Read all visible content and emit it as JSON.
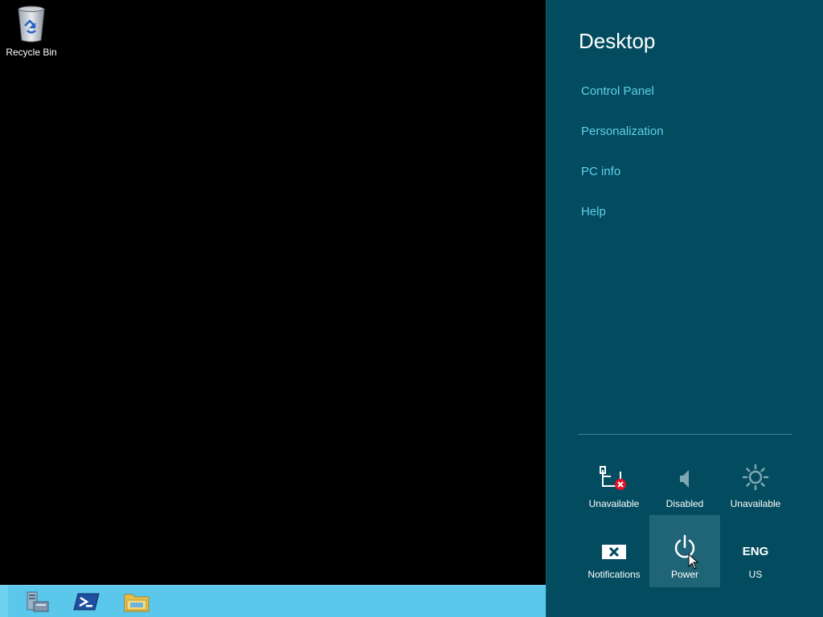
{
  "desktop": {
    "icons": [
      {
        "label": "Recycle Bin",
        "icon": "recycle-bin-icon"
      }
    ]
  },
  "taskbar": {
    "buttons": [
      {
        "name": "server-manager",
        "icon": "server-manager-icon"
      },
      {
        "name": "powershell",
        "icon": "powershell-icon"
      },
      {
        "name": "file-explorer",
        "icon": "folder-icon"
      }
    ],
    "color": "#5bc7ea"
  },
  "charms": {
    "title": "Desktop",
    "background": "#034c5f",
    "link_color": "#5fd0e8",
    "links": [
      {
        "label": "Control Panel"
      },
      {
        "label": "Personalization"
      },
      {
        "label": "PC info"
      },
      {
        "label": "Help"
      }
    ],
    "tiles": [
      {
        "label": "Unavailable",
        "icon": "network-unavailable-icon"
      },
      {
        "label": "Disabled",
        "icon": "volume-icon"
      },
      {
        "label": "Unavailable",
        "icon": "brightness-icon"
      },
      {
        "label": "Notifications",
        "icon": "notifications-icon"
      },
      {
        "label": "Power",
        "icon": "power-icon",
        "hover": true
      },
      {
        "label": "US",
        "icon_text": "ENG"
      }
    ]
  }
}
